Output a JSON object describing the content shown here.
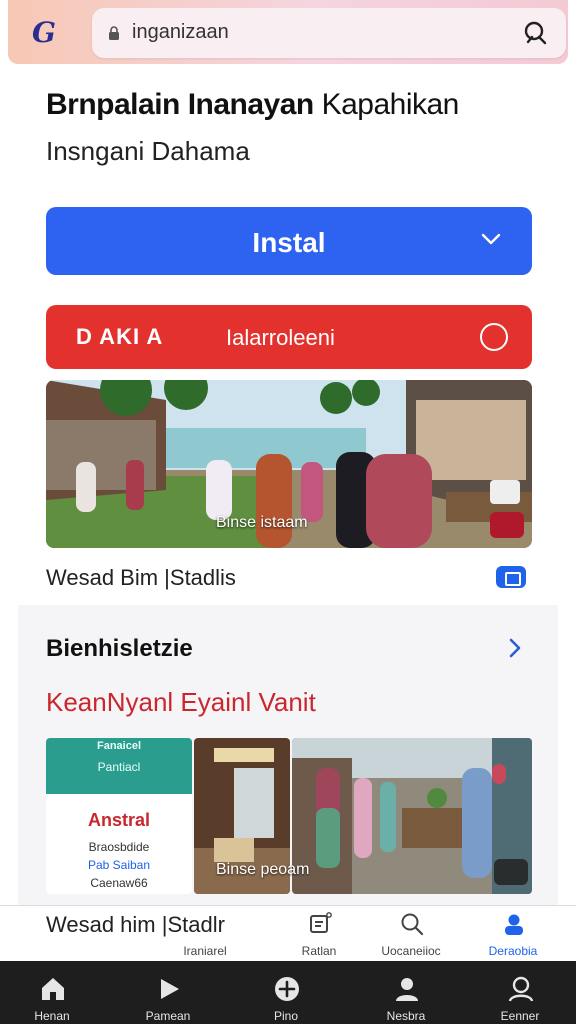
{
  "browser": {
    "logo": "G",
    "url": "inganizaan"
  },
  "header": {
    "title_bold": "Brnpalain Inanayan",
    "title_light": " Kapahikan",
    "subtitle": "Insngani Dahama"
  },
  "actions": {
    "install_label": "Instal",
    "red_brand": "D AKI A",
    "red_label": "Ialarroleeni"
  },
  "hero": {
    "caption": "Binse istaam",
    "meta": "Wesad Bim |Stadlis"
  },
  "section": {
    "title": "Bienhisletzie",
    "highlight": "KeanNyanl Eyainl Vanit",
    "tile1": {
      "head_top": "Fanaicel",
      "head_sub": "Pantiacl",
      "title": "Anstral",
      "line1": "Braosbdide",
      "line2": "Pab Saiban",
      "line3": "Caenaw66"
    },
    "tile_caption": "Binse peoam"
  },
  "bottom": {
    "title": "Wesad him |Stadlr",
    "tabs": [
      {
        "label": "Iraniarel"
      },
      {
        "label": "Ratlan"
      },
      {
        "label": "Uocaneiioc"
      },
      {
        "label": "Deraobia"
      }
    ]
  },
  "nav": {
    "items": [
      {
        "label": "Henan"
      },
      {
        "label": "Pamean"
      },
      {
        "label": "Pino"
      },
      {
        "label": "Nesbra"
      },
      {
        "label": "Eenner"
      }
    ]
  },
  "colors": {
    "primary": "#2e62f0",
    "danger": "#e3312e",
    "accent": "#1e63e9"
  }
}
